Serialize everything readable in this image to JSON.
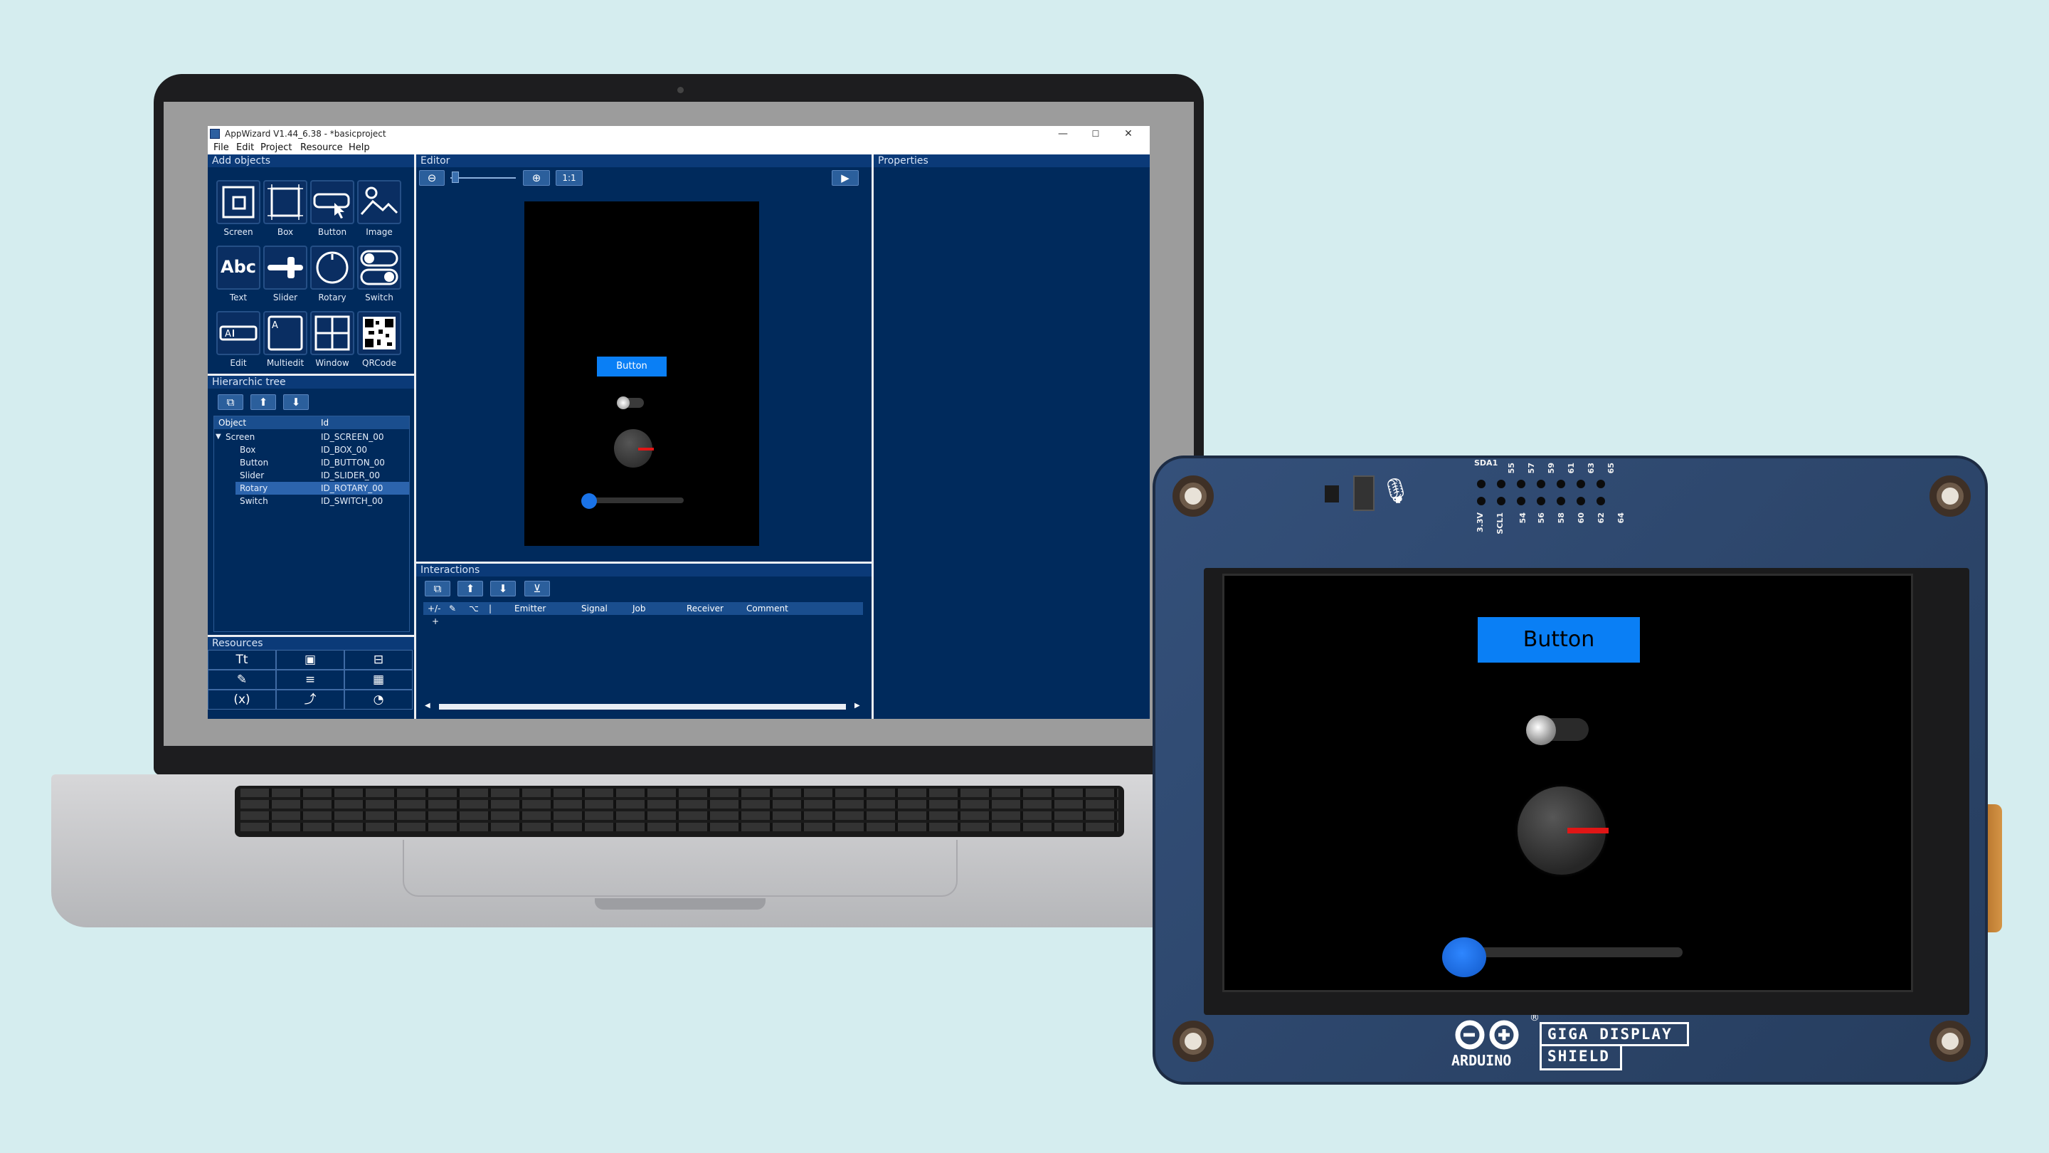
{
  "app": {
    "title": "AppWizard V1.44_6.38 - *basicproject",
    "window_controls": [
      "—",
      "☐",
      "✕"
    ],
    "menu": [
      "File",
      "Edit",
      "Project",
      "Resource",
      "Help"
    ]
  },
  "add_objects": {
    "header": "Add objects",
    "items": [
      {
        "label": "Screen",
        "icon": "screen-icon"
      },
      {
        "label": "Box",
        "icon": "box-icon"
      },
      {
        "label": "Button",
        "icon": "button-icon"
      },
      {
        "label": "Image",
        "icon": "image-icon"
      },
      {
        "label": "Text",
        "icon": "text-icon",
        "glyph": "Abc"
      },
      {
        "label": "Slider",
        "icon": "slider-icon"
      },
      {
        "label": "Rotary",
        "icon": "rotary-icon"
      },
      {
        "label": "Switch",
        "icon": "switch-icon"
      },
      {
        "label": "Edit",
        "icon": "edit-icon"
      },
      {
        "label": "Multiedit",
        "icon": "multiedit-icon"
      },
      {
        "label": "Window",
        "icon": "window-icon"
      },
      {
        "label": "QRCode",
        "icon": "qrcode-icon"
      }
    ]
  },
  "hier_tree": {
    "header": "Hierarchic tree",
    "columns": [
      "Object",
      "Id"
    ],
    "rows": [
      {
        "object": "Screen",
        "id": "ID_SCREEN_00",
        "expanded": true
      },
      {
        "object": "Box",
        "id": "ID_BOX_00"
      },
      {
        "object": "Button",
        "id": "ID_BUTTON_00"
      },
      {
        "object": "Slider",
        "id": "ID_SLIDER_00"
      },
      {
        "object": "Rotary",
        "id": "ID_ROTARY_00",
        "selected": true
      },
      {
        "object": "Switch",
        "id": "ID_SWITCH_00"
      }
    ]
  },
  "resources": {
    "header": "Resources",
    "icons": [
      "font-icon",
      "image-icon",
      "binary-icon",
      "text-edit-icon",
      "list-icon",
      "table-icon",
      "variable-icon",
      "chart-icon",
      "shape-icon"
    ],
    "glyphs": [
      "Tt",
      "▣",
      "⊟",
      "✎",
      "≡",
      "▦",
      "(x)",
      "⤴",
      "◔"
    ]
  },
  "editor": {
    "header": "Editor",
    "zoom_label": "1:1",
    "preview": {
      "button_label": "Button"
    }
  },
  "interactions": {
    "header": "Interactions",
    "columns": [
      "+/-",
      "✎",
      "⌥",
      "|",
      "Emitter",
      "Signal",
      "Job",
      "Receiver",
      "Comment"
    ],
    "add_row": "+"
  },
  "properties": {
    "header": "Properties"
  },
  "device": {
    "button_label": "Button",
    "brand": "ARDUINO",
    "brand_mark": "®",
    "product_line1": "GIGA DISPLAY",
    "product_line2": "SHIELD",
    "pin_labels": [
      "SDA1",
      "55",
      "57",
      "59",
      "61",
      "63",
      "65",
      "3.3V",
      "SCL1",
      "54",
      "56",
      "58",
      "60",
      "62",
      "64"
    ],
    "rotary_level": 0.25,
    "slider_level": 0.08,
    "switch_on": false
  },
  "colors": {
    "app_bg": "#002a5c",
    "accent_button": "#0a7ff5",
    "rotary_indicator": "#e01616",
    "slider_knob": "#1a73e8"
  }
}
